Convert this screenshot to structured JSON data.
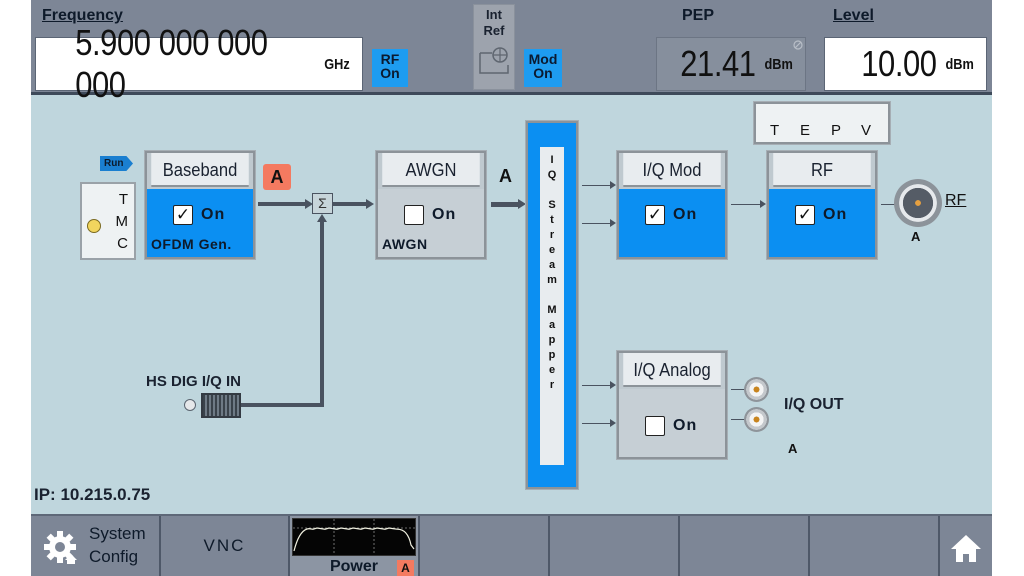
{
  "header": {
    "frequency": {
      "label": "Frequency",
      "value": "5.900 000 000 000",
      "unit": "GHz"
    },
    "rf_status": {
      "line1": "RF",
      "line2": "On"
    },
    "int_ref": {
      "line1": "Int",
      "line2": "Ref",
      "icon": "reference-clock-icon"
    },
    "mod_status": {
      "line1": "Mod",
      "line2": "On"
    },
    "pep": {
      "label": "PEP",
      "value": "21.41",
      "unit": "dBm"
    },
    "level": {
      "label": "Level",
      "value": "10.00",
      "unit": "dBm"
    }
  },
  "diagram": {
    "run_flag": "Run",
    "tmc": {
      "t": "T",
      "m": "M",
      "c": "C"
    },
    "baseband": {
      "title": "Baseband",
      "checkbox_label": "On",
      "checked": true,
      "sub_label": "OFDM Gen.",
      "badge": "A"
    },
    "sigma": "Σ",
    "awgn": {
      "title": "AWGN",
      "checkbox_label": "On",
      "checked": false,
      "sub_label": "AWGN"
    },
    "path_label_a": "A",
    "stream_mapper": {
      "letters": [
        "I",
        "Q",
        "",
        "S",
        "t",
        "r",
        "e",
        "a",
        "m",
        "",
        "M",
        "a",
        "p",
        "p",
        "e",
        "r"
      ]
    },
    "iq_mod": {
      "title": "I/Q Mod",
      "checkbox_label": "On",
      "checked": true
    },
    "tepv": {
      "t": "T",
      "e": "E",
      "p": "P",
      "v": "V"
    },
    "rf": {
      "title": "RF",
      "checkbox_label": "On",
      "checked": true
    },
    "rf_output": {
      "label": "RF",
      "path": "A"
    },
    "iq_analog": {
      "title": "I/Q Analog",
      "checkbox_label": "On",
      "checked": false
    },
    "iq_out": {
      "label": "I/Q OUT",
      "path": "A"
    },
    "hs_dig_in": {
      "label": "HS DIG I/Q IN"
    },
    "check_glyph": "✓"
  },
  "status": {
    "ip": "IP: 10.215.0.75"
  },
  "softkeys": {
    "system_config": {
      "line1": "System",
      "line2": "Config"
    },
    "vnc": "VNC",
    "power": {
      "label": "Power",
      "badge": "A"
    },
    "home_icon": "home-icon"
  }
}
